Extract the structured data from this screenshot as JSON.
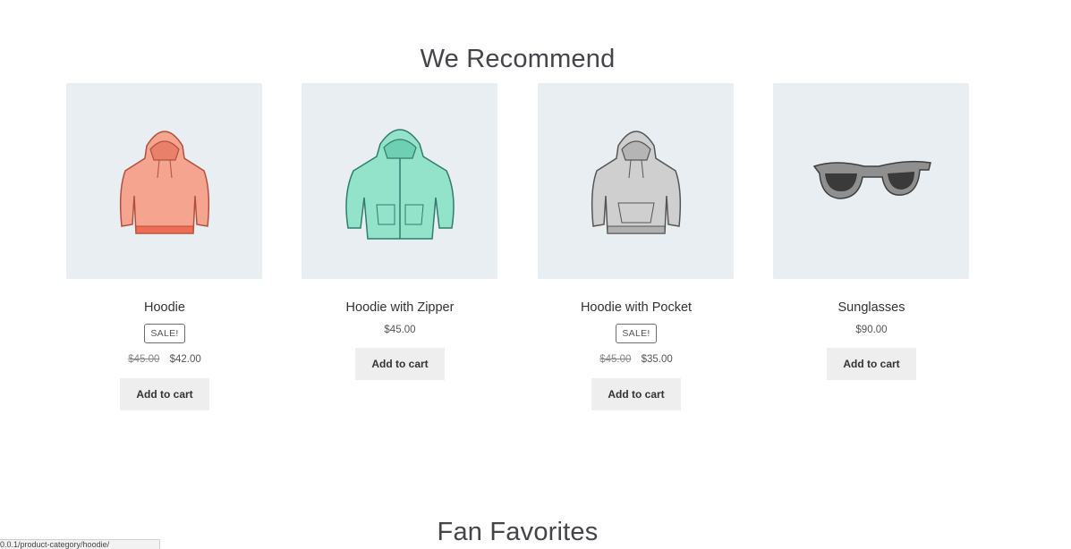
{
  "sections": {
    "recommend_title": "We Recommend",
    "favorites_title": "Fan Favorites"
  },
  "products": [
    {
      "name": "Hoodie",
      "sale_badge": "SALE!",
      "old_price": "$45.00",
      "price": "$42.00",
      "button": "Add to cart",
      "icon": "hoodie-coral-icon",
      "color": "#f4a28f"
    },
    {
      "name": "Hoodie with Zipper",
      "price": "$45.00",
      "button": "Add to cart",
      "icon": "zip-hoodie-mint-icon",
      "color": "#8fe0c8"
    },
    {
      "name": "Hoodie with Pocket",
      "sale_badge": "SALE!",
      "old_price": "$45.00",
      "price": "$35.00",
      "button": "Add to cart",
      "icon": "hoodie-grey-icon",
      "color": "#c9c9c9"
    },
    {
      "name": "Sunglasses",
      "price": "$90.00",
      "button": "Add to cart",
      "icon": "sunglasses-icon",
      "color": "#8c8c8c"
    }
  ],
  "status_bar": {
    "url": "0.0.1/product-category/hoodie/"
  }
}
